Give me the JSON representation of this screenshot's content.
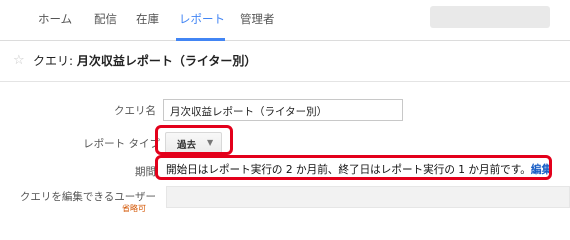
{
  "nav": {
    "items": [
      {
        "label": "ホーム"
      },
      {
        "label": "配信"
      },
      {
        "label": "在庫"
      },
      {
        "label": "レポート"
      },
      {
        "label": "管理者"
      }
    ]
  },
  "header": {
    "prefix": "クエリ: ",
    "title": "月次収益レポート（ライター別）"
  },
  "form": {
    "query_name_label": "クエリ名",
    "query_name_value": "月次収益レポート（ライター別）",
    "report_type_label": "レポート タイプ",
    "report_type_value": "過去",
    "period_label": "期間",
    "period_text": "開始日はレポート実行の 2 か月前、終了日はレポート実行の 1 か月前です。",
    "period_edit": "編集",
    "editors_label": "クエリを編集できるユーザー",
    "editors_optional": "省略可"
  },
  "colors": {
    "accent": "#4285f4",
    "highlight": "#e3001b",
    "link": "#1a5fc6"
  }
}
